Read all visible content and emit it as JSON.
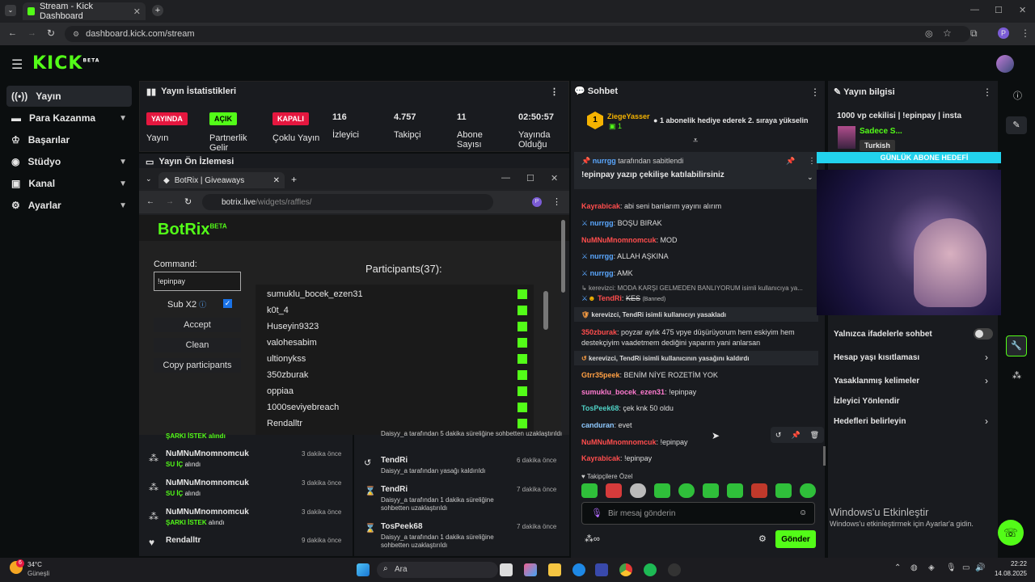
{
  "browser": {
    "tab_title": "Stream - Kick Dashboard",
    "url": "dashboard.kick.com/stream",
    "new_tab": "+",
    "profile": "P"
  },
  "kick": {
    "logo": "KICK",
    "logo_beta": "BETA"
  },
  "sidebar": {
    "items": [
      {
        "label": "Yayın"
      },
      {
        "label": "Para Kazanma"
      },
      {
        "label": "Başarılar"
      },
      {
        "label": "Stüdyo"
      },
      {
        "label": "Kanal"
      },
      {
        "label": "Ayarlar"
      }
    ]
  },
  "stats": {
    "title": "Yayın İstatistikleri",
    "live_badge": "YAYINDA",
    "live_label": "Yayın",
    "partner_badge": "AÇIK",
    "partner_label": "Partnerlik Gelir",
    "multi_badge": "KAPALI",
    "multi_label": "Çoklu Yayın",
    "viewers": "116",
    "viewers_label": "İzleyici",
    "followers": "4.757",
    "followers_label": "Takipçi",
    "subs": "11",
    "subs_label": "Abone Sayısı",
    "uptime": "02:50:57",
    "uptime_label": "Yayında Olduğu"
  },
  "preview": {
    "title": "Yayın Ön İzlemesi"
  },
  "botrix": {
    "tab_title": "BotRix | Giveaways",
    "url_host": "botrix.live",
    "url_path": "/widgets/raffles/",
    "logo": "BotRix",
    "beta": "BETA",
    "command_label": "Command:",
    "command_value": "!epinpay",
    "sub_label": "Sub X2",
    "accept": "Accept",
    "clean": "Clean",
    "copy": "Copy participants",
    "participants_title": "Participants(37):",
    "participants": [
      "sumuklu_bocek_ezen31",
      "k0t_4",
      "Huseyin9323",
      "valohesabim",
      "ultionykss",
      "350zburak",
      "oppiaa",
      "1000seviyebreach",
      "Rendalltr"
    ]
  },
  "activity": {
    "rows": [
      {
        "name": "NuMNuMnomnomcuk",
        "action": "SU İÇ",
        "suffix": "alındı",
        "time": "3 dakika önce"
      },
      {
        "name": "NuMNuMnomnomcuk",
        "action": "ŞARKI İSTEK",
        "suffix": "alındı",
        "time": "3 dakika önce"
      },
      {
        "name": "Rendalltr",
        "action": "",
        "suffix": "",
        "time": "9 dakika önce"
      }
    ],
    "partial": "ŞARKI İSTEK alındı"
  },
  "modlog": {
    "partial": "Daisyy_a tarafından 5 dakika süreliğine sohbetten uzaklaştırıldı",
    "rows": [
      {
        "name": "TendRi",
        "detail": "Daisyy_a tarafından yasağı kaldırıldı",
        "time": "6 dakika önce"
      },
      {
        "name": "TendRi",
        "detail": "Daisyy_a tarafından 1 dakika süreliğine sohbetten uzaklaştırıldı",
        "time": "7 dakika önce"
      },
      {
        "name": "TosPeek68",
        "detail": "Daisyy_a tarafından 1 dakika süreliğine sohbetten uzaklaştırıldı",
        "time": "7 dakika önce"
      }
    ]
  },
  "chat": {
    "title": "Sohbet",
    "gift_user": "ZiegeYasser",
    "gift_count": "1",
    "gift_text": "1 abonelik hediye ederek 2. sıraya yükselin",
    "pinned_by": "nurrgg",
    "pinned_by_suffix": "tarafından sabitlendi",
    "pinned_msg": "!epinpay yazıp çekilişe katılabilirsiniz",
    "messages": [
      {
        "user": "Kayrabicak",
        "text": ": abi seni banlarım yayını alırım"
      },
      {
        "user": "nurrgg",
        "text": ": BOŞU BIRAK"
      },
      {
        "user": "NuMNuMnomnomcuk",
        "text": ": MOD"
      },
      {
        "user": "nurrgg",
        "text": ": ALLAH AŞKINA"
      },
      {
        "user": "nurrgg",
        "text": ": AMK"
      },
      {
        "user": "350zburak",
        "text": ": poyzar aylık 475 vpye düşürüyorum hem eskiyim hem destekçiyim vaadetmem dediğini yaparım yani anlarsan"
      },
      {
        "user": "Gtrr35peek",
        "text": ": BENİM NİYE ROZETİM YOK"
      },
      {
        "user": "sumuklu_bocek_ezen31",
        "text": ": !epinpay"
      },
      {
        "user": "TosPeek68",
        "text": ": çek knk 50 oldu"
      },
      {
        "user": "canduran",
        "text": ": evet"
      },
      {
        "user": "NuMNuMnomnomcuk",
        "text": ": !epinpay"
      },
      {
        "user": "Kayrabicak",
        "text": ": !epinpay"
      }
    ],
    "reply_line": "kerevizci: MODA KARŞI GELMEDEN BANLIYORUM isimli kullanıcıya ya...",
    "banned_user": "TendRi",
    "banned_text": "KES",
    "banned_tag": "(Banned)",
    "ban_sys": "kerevizci, TendRi isimli kullanıcıyı yasakladı",
    "unban_sys": "kerevizci, TendRi isimli kullanıcının yasağını kaldırdı",
    "followers_only": "Takipçilere Özel",
    "input_placeholder": "Bir mesaj gönderin",
    "send": "Gönder"
  },
  "info": {
    "title": "Yayın bilgisi",
    "stream_title": "1000 vp cekilisi | !epinpay | insta",
    "channel": "Sadece S...",
    "language": "Turkish",
    "goal_banner": "GÜNLÜK ABONE HEDEFİ",
    "settings": [
      {
        "label": "Yalnızca ifadelerle sohbet"
      },
      {
        "label": "Hesap yaşı kısıtlaması"
      },
      {
        "label": "Yasaklanmış kelimeler"
      },
      {
        "label": "İzleyici Yönlendir"
      },
      {
        "label": "Hedefleri belirleyin"
      }
    ]
  },
  "windows": {
    "activate_title": "Windows'u Etkinleştir",
    "activate_sub": "Windows'u etkinleştirmek için Ayarlar'a gidin.",
    "weather_temp": "34°C",
    "weather_desc": "Güneşli",
    "weather_badge": "6",
    "search": "Ara",
    "time": "22:22",
    "date": "14.08.2025"
  },
  "colors": {
    "kick_green": "#53fc18",
    "live_red": "#e5173f",
    "goal_cyan": "#22d3ee"
  }
}
